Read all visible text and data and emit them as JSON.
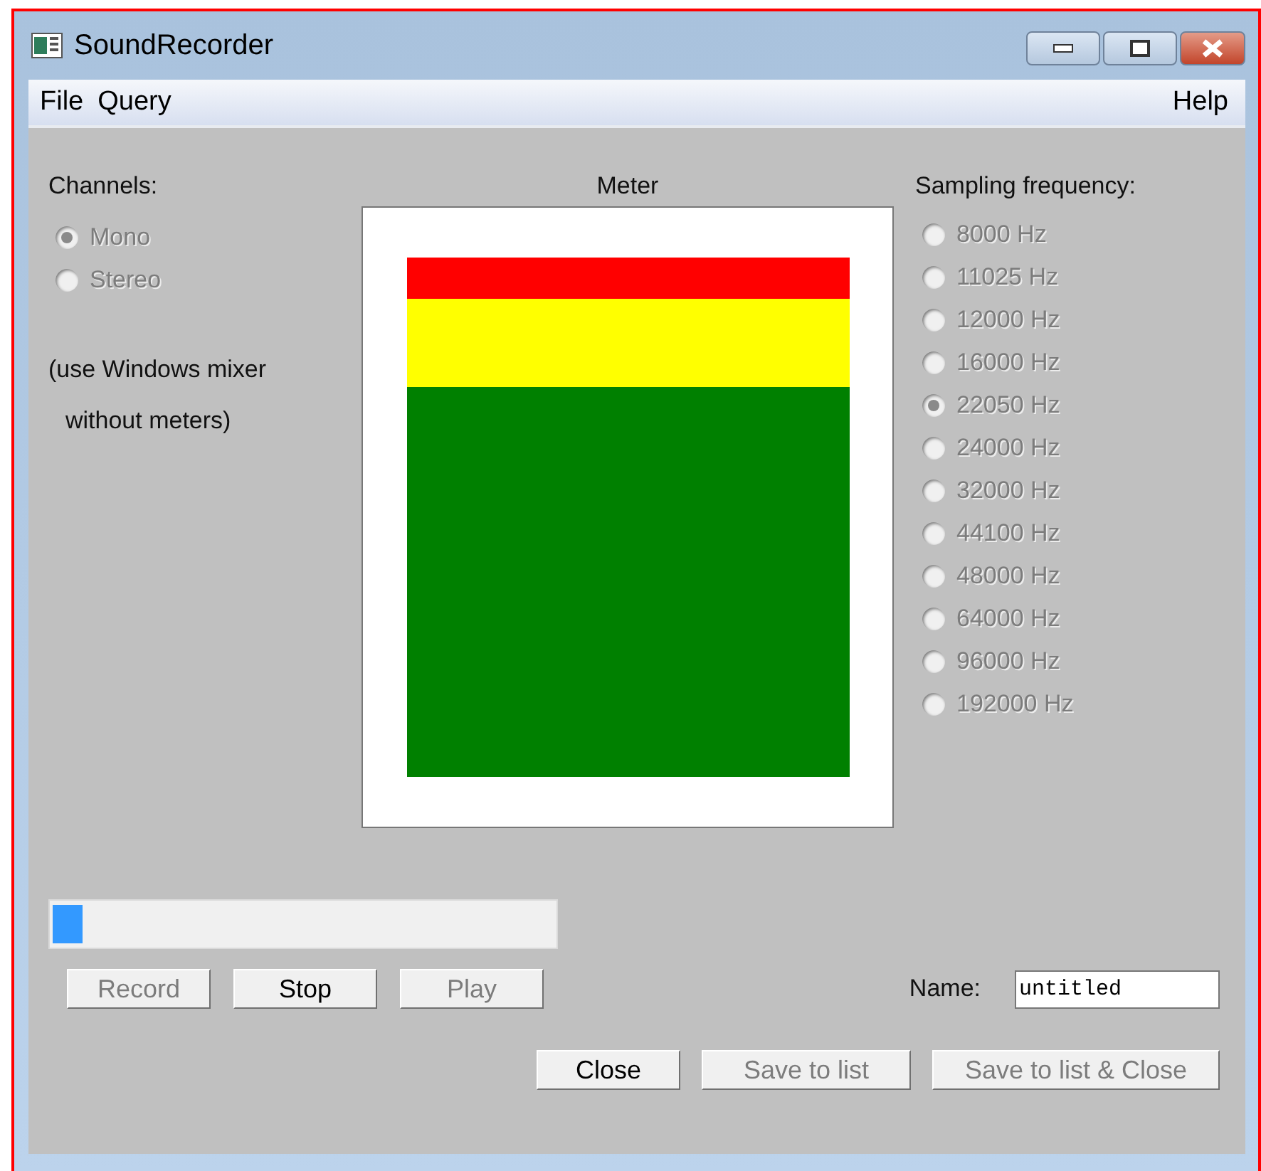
{
  "window": {
    "title": "SoundRecorder"
  },
  "menu": {
    "items": [
      "File",
      "Query"
    ],
    "help": "Help"
  },
  "channels": {
    "label": "Channels:",
    "options": [
      {
        "label": "Mono",
        "selected": true,
        "disabled": true
      },
      {
        "label": "Stereo",
        "selected": false,
        "disabled": true
      }
    ],
    "note": [
      "(use Windows mixer",
      "without meters)"
    ]
  },
  "meter": {
    "label": "Meter",
    "segments": [
      {
        "color": "#ff0000"
      },
      {
        "color": "#ffff00"
      },
      {
        "color": "#008000"
      }
    ]
  },
  "sampling": {
    "label": "Sampling frequency:",
    "options": [
      {
        "label": "8000 Hz",
        "selected": false,
        "disabled": true
      },
      {
        "label": "11025 Hz",
        "selected": false,
        "disabled": true
      },
      {
        "label": "12000 Hz",
        "selected": false,
        "disabled": true
      },
      {
        "label": "16000 Hz",
        "selected": false,
        "disabled": true
      },
      {
        "label": "22050 Hz",
        "selected": true,
        "disabled": true
      },
      {
        "label": "24000 Hz",
        "selected": false,
        "disabled": true
      },
      {
        "label": "32000 Hz",
        "selected": false,
        "disabled": true
      },
      {
        "label": "44100 Hz",
        "selected": false,
        "disabled": true
      },
      {
        "label": "48000 Hz",
        "selected": false,
        "disabled": true
      },
      {
        "label": "64000 Hz",
        "selected": false,
        "disabled": true
      },
      {
        "label": "96000 Hz",
        "selected": false,
        "disabled": true
      },
      {
        "label": "192000 Hz",
        "selected": false,
        "disabled": true
      }
    ]
  },
  "progress": {
    "level": 0.06
  },
  "transport": [
    {
      "label": "Record",
      "disabled": true
    },
    {
      "label": "Stop",
      "disabled": false
    },
    {
      "label": "Play",
      "disabled": true
    }
  ],
  "name": {
    "label": "Name:",
    "value": "untitled"
  },
  "actions": [
    {
      "label": "Close",
      "disabled": false
    },
    {
      "label": "Save to list",
      "disabled": true
    },
    {
      "label": "Save to list & Close",
      "disabled": true
    }
  ]
}
